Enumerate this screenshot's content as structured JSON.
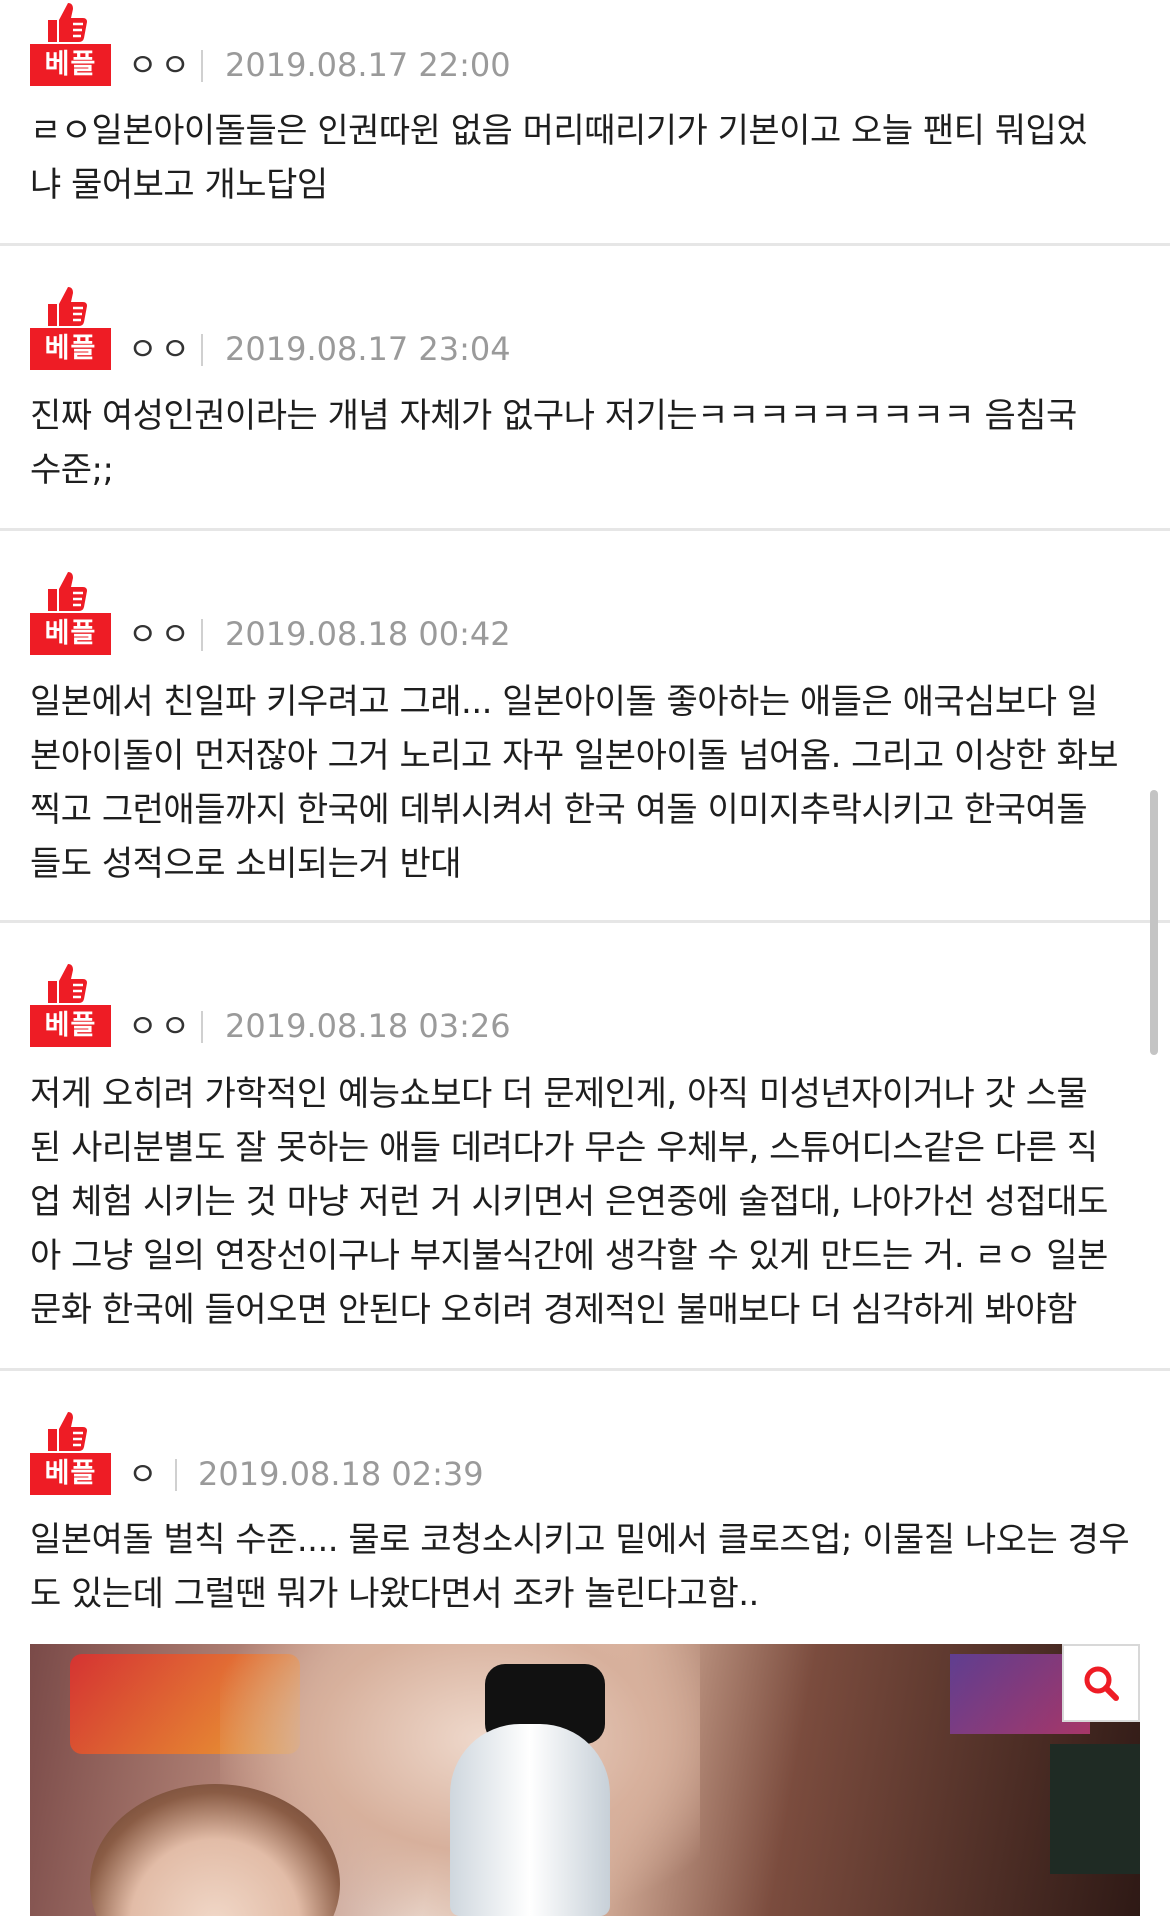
{
  "badge_label": "베플",
  "colors": {
    "accent": "#ee1c25",
    "date": "#9a9a9a",
    "divider": "#e6e6e6"
  },
  "icons": {
    "best": "thumbs-up-icon",
    "zoom": "search-icon"
  },
  "comments": [
    {
      "nickname": "ㅇㅇ",
      "date": "2019.08.17 22:00",
      "lines": [
        "ㄹㅇ일본아이돌들은 인권따윈 없음 머리때리기가 기본이고 오늘 팬티 뭐입었",
        "냐 물어보고 개노답임"
      ]
    },
    {
      "nickname": "ㅇㅇ",
      "date": "2019.08.17 23:04",
      "lines": [
        "진짜 여성인권이라는 개념 자체가 없구나 저기는ㅋㅋㅋㅋㅋㅋㅋㅋㅋ 음침국",
        "수준;;"
      ]
    },
    {
      "nickname": "ㅇㅇ",
      "date": "2019.08.18 00:42",
      "lines": [
        "일본에서 친일파 키우려고 그래... 일본아이돌 좋아하는 애들은 애국심보다 일",
        "본아이돌이 먼저잖아 그거 노리고 자꾸 일본아이돌 넘어옴. 그리고 이상한 화보",
        "찍고 그런애들까지 한국에 데뷔시켜서 한국 여돌 이미지추락시키고 한국여돌",
        "들도 성적으로 소비되는거 반대"
      ]
    },
    {
      "nickname": "ㅇㅇ",
      "date": "2019.08.18 03:26",
      "lines": [
        "저게 오히려 가학적인 예능쇼보다 더 문제인게, 아직 미성년자이거나 갓 스물",
        "된 사리분별도 잘 못하는 애들 데려다가 무슨 우체부, 스튜어디스같은 다른 직",
        "업 체험 시키는 것 마냥 저런 거 시키면서 은연중에 술접대, 나아가선 성접대도",
        "아 그냥 일의 연장선이구나 부지불식간에 생각할 수 있게 만드는 거. ㄹㅇ 일본",
        "문화 한국에 들어오면 안된다 오히려 경제적인 불매보다 더 심각하게 봐야함"
      ]
    },
    {
      "nickname": "ㅇ",
      "date": "2019.08.18 02:39",
      "lines": [
        "일본여돌 벌칙 수준.... 물로 코청소시키고 밑에서 클로즈업; 이물질 나오는 경우",
        "도 있는데 그럴땐 뭐가 나왔다면서 조카 놀린다고함.."
      ]
    }
  ]
}
